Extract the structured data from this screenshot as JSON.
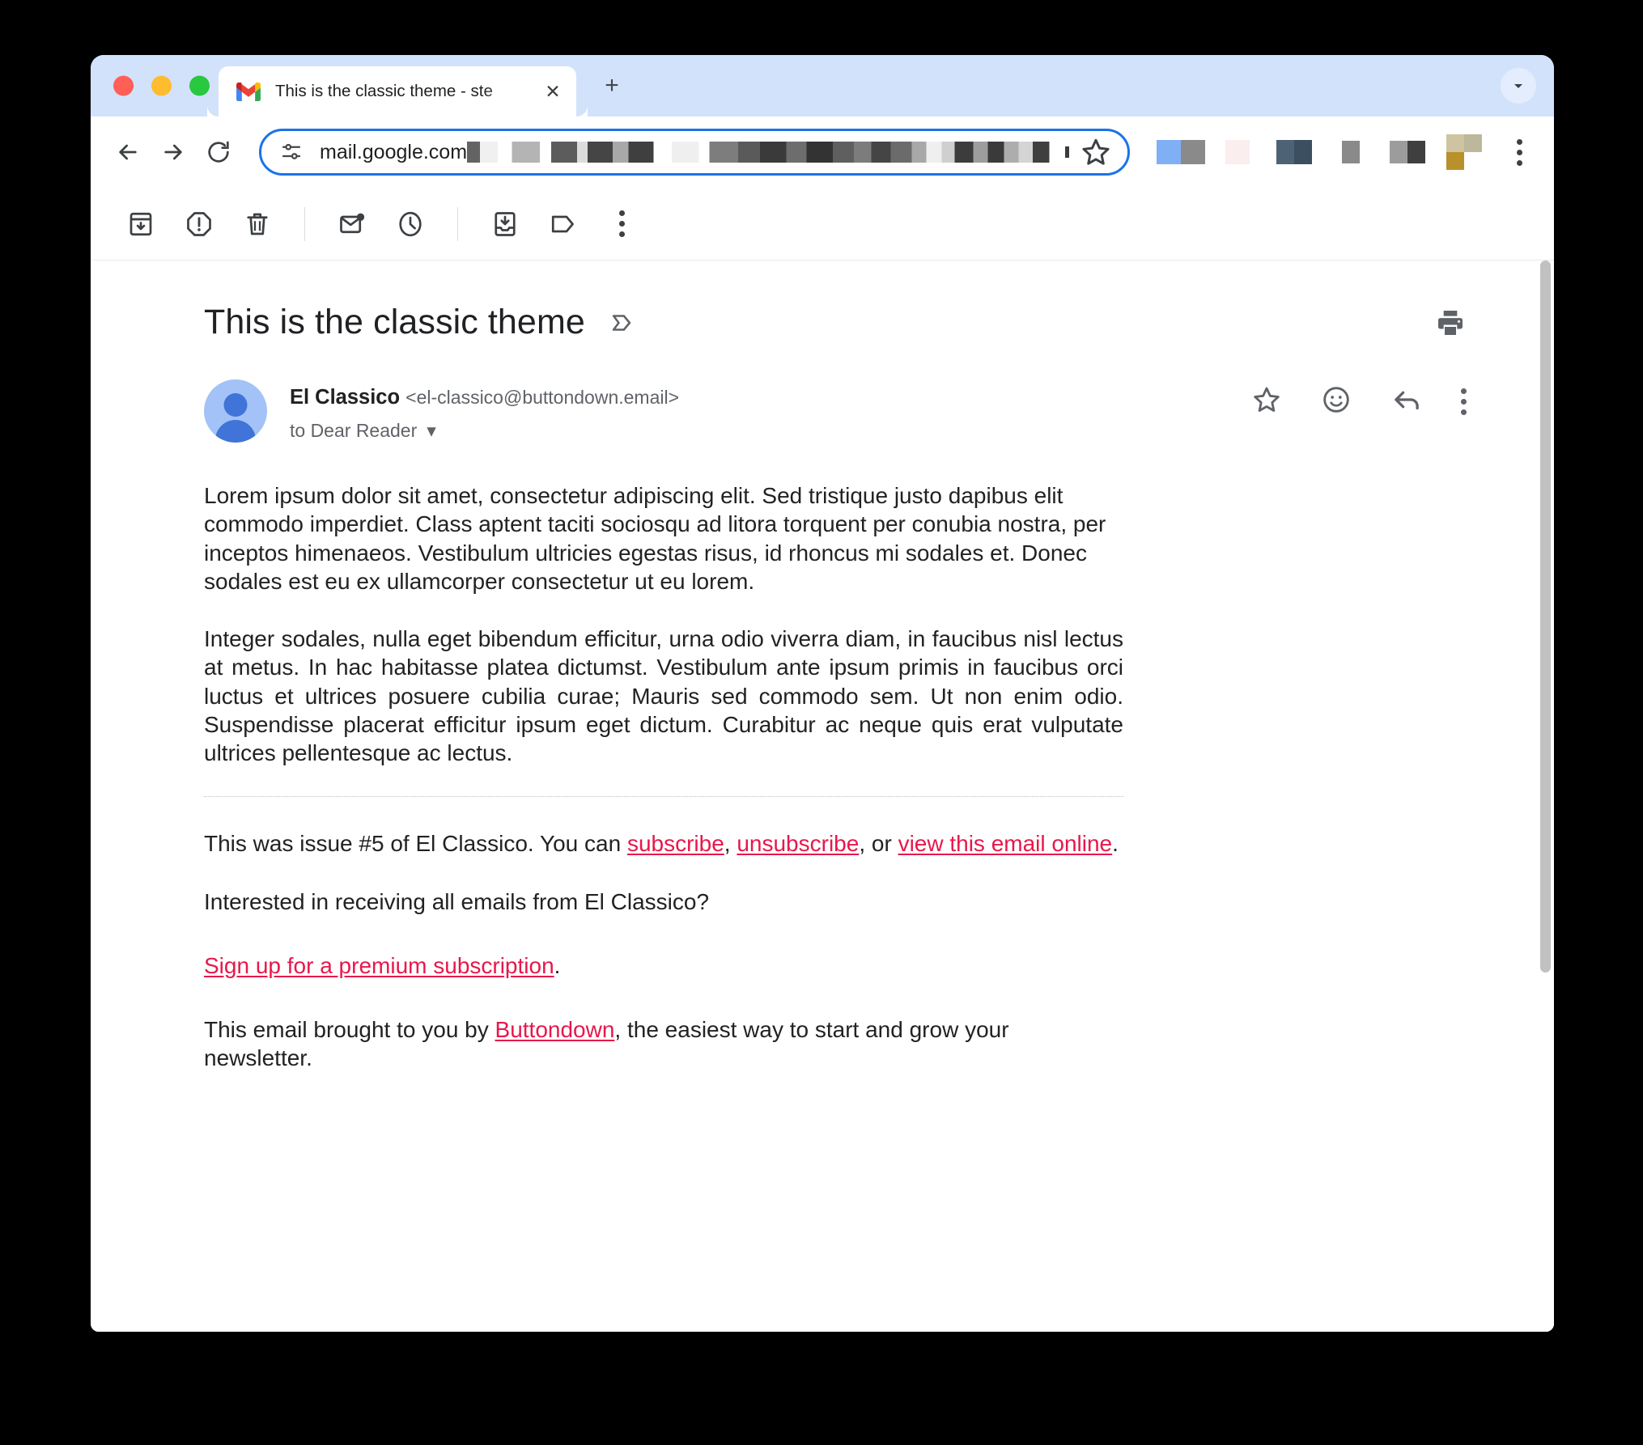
{
  "browser": {
    "tab": {
      "title": "This is the classic theme - ste",
      "favicon": "gmail-icon",
      "close_label": "✕"
    },
    "new_tab_label": "+",
    "tab_list_chevron": "⌄",
    "nav": {
      "back": "←",
      "forward": "→",
      "reload": "↻"
    },
    "address": {
      "url": "mail.google.com",
      "site_info_icon": "tune-icon",
      "bookmark_icon": "star-icon"
    },
    "menu_icon": "three-dot-menu-icon",
    "extensions": [
      {
        "name": "extension-1",
        "colors": [
          "#7fb0f5",
          "#8a8a8a"
        ]
      },
      {
        "name": "extension-2",
        "colors": [
          "#faeeee",
          "#faeeee"
        ]
      },
      {
        "name": "extension-3",
        "colors": [
          "#4e6275",
          "#3b4f61"
        ]
      },
      {
        "name": "extension-4",
        "colors": [
          "#8a8a8a",
          "#8a8a8a"
        ]
      },
      {
        "name": "extension-5",
        "colors": [
          "#9c9c9c",
          "#3f3f3f"
        ]
      },
      {
        "name": "extension-6",
        "colors": [
          "#cfc4a1",
          "#bdb79b",
          "#b8912a"
        ]
      }
    ]
  },
  "gmail": {
    "toolbar": [
      {
        "name": "archive-button",
        "icon": "archive-icon"
      },
      {
        "name": "report-spam-button",
        "icon": "report-spam-icon"
      },
      {
        "name": "delete-button",
        "icon": "trash-icon"
      },
      {
        "name": "mark-unread-button",
        "icon": "mark-unread-icon"
      },
      {
        "name": "snooze-button",
        "icon": "clock-icon"
      },
      {
        "name": "move-to-inbox-button",
        "icon": "move-to-inbox-icon"
      },
      {
        "name": "labels-button",
        "icon": "label-icon"
      },
      {
        "name": "more-options-button",
        "icon": "three-dot-menu-icon"
      }
    ],
    "subject": "This is the classic theme",
    "subject_chip_icon": "inbox-chevron-icon",
    "print_icon": "print-icon",
    "sender": {
      "name": "El Classico",
      "email": "<el-classico@buttondown.email>",
      "recipient": "to Dear Reader",
      "recipient_caret": "▾"
    },
    "message_actions": [
      {
        "name": "star-button",
        "icon": "star-icon"
      },
      {
        "name": "add-reaction-button",
        "icon": "emoji-smile-icon"
      },
      {
        "name": "reply-button",
        "icon": "reply-arrow-icon"
      },
      {
        "name": "more-message-options-button",
        "icon": "three-dot-menu-icon"
      }
    ],
    "body": {
      "paragraph_1": "Lorem ipsum dolor sit amet, consectetur adipiscing elit. Sed tristique justo dapibus elit commodo imperdiet. Class aptent taciti sociosqu ad litora torquent per conubia nostra, per inceptos himenaeos. Vestibulum ultricies egestas risus, id rhoncus mi sodales et. Donec sodales est eu ex ullamcorper consectetur ut eu lorem.",
      "paragraph_2": "Integer sodales, nulla eget bibendum efficitur, urna odio viverra diam, in faucibus nisl lectus at metus. In hac habitasse platea dictumst. Vestibulum ante ipsum primis in faucibus orci luctus et ultrices posuere cubilia curae; Mauris sed commodo sem. Ut non enim odio. Suspendisse placerat efficitur ipsum eget dictum. Curabitur ac neque quis erat vulputate ultrices pellentesque ac lectus.",
      "issue_prefix": "This was issue #5 of El Classico. You can ",
      "link_subscribe": "subscribe",
      "issue_sep_1": ", ",
      "link_unsubscribe": "unsubscribe",
      "issue_sep_2": ", or ",
      "link_view_online": "view this email online",
      "issue_suffix": ".",
      "interested_line": "Interested in receiving all emails from El Classico?",
      "link_premium": "Sign up for a premium subscription",
      "premium_suffix": ".",
      "brought_prefix": "This email brought to you by ",
      "link_buttondown": "Buttondown",
      "brought_suffix": ", the easiest way to start and grow your newsletter."
    }
  },
  "colors": {
    "tab_strip": "#d3e2fb",
    "omnibox_border": "#1a73e8",
    "link": "#e8174b",
    "avatar": "#a3c2f7"
  }
}
